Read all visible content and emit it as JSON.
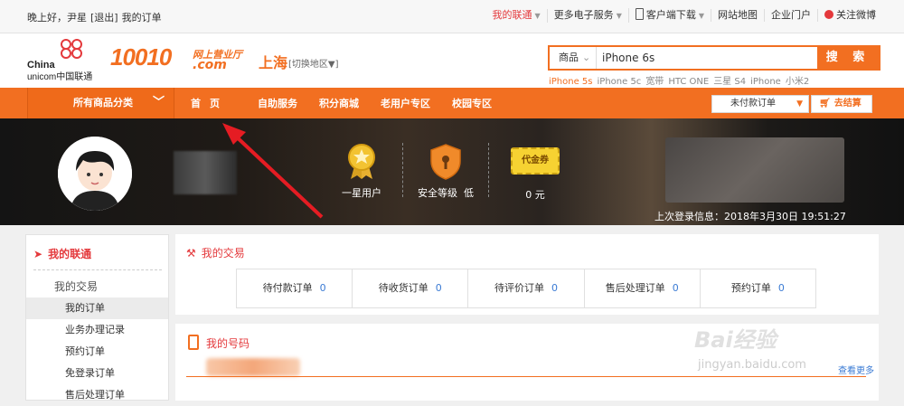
{
  "topbar": {
    "greeting": "晚上好，尹星",
    "logout": "[退出]",
    "my_orders": "我的订单",
    "links": [
      "我的联通",
      "更多电子服务",
      "客户端下载",
      "网站地图",
      "企业门户",
      "关注微博"
    ]
  },
  "header": {
    "logo_line1": "China",
    "logo_line2": "unicom中国联通",
    "brand": "10010",
    "brand_sub": "网上营业厅",
    "brand_com": ".com",
    "city": "上海",
    "city_switch": "[切换地区▼]",
    "search_category": "商品",
    "search_value": "iPhone 6s",
    "search_button": "搜 索",
    "hot_words": [
      "iPhone 5s",
      "iPhone 5c",
      "宽带",
      "HTC ONE",
      "三星 S4",
      "iPhone",
      "小米2"
    ]
  },
  "nav": {
    "all_categories": "所有商品分类",
    "items": [
      "首页",
      "自助服务",
      "积分商城",
      "老用户专区",
      "校园专区"
    ],
    "unpaid_select": "未付款订单",
    "checkout": "去结算"
  },
  "banner": {
    "level_label": "一星用户",
    "security_label": "安全等级  低",
    "coupon_badge": "代金券",
    "coupon_value": "0 元",
    "last_login": "上次登录信息：2018年3月30日 19:51:27"
  },
  "sidebar": {
    "title": "我的联通",
    "section": "我的交易",
    "items": [
      "我的订单",
      "业务办理记录",
      "预约订单",
      "免登录订单",
      "售后处理订单"
    ]
  },
  "transactions": {
    "title": "我的交易",
    "orders": [
      {
        "label": "待付款订单",
        "count": "0"
      },
      {
        "label": "待收货订单",
        "count": "0"
      },
      {
        "label": "待评价订单",
        "count": "0"
      },
      {
        "label": "售后处理订单",
        "count": "0"
      },
      {
        "label": "预约订单",
        "count": "0"
      }
    ]
  },
  "numbers": {
    "title": "我的号码",
    "more": "查看更多"
  },
  "watermark": {
    "text1": "Bai经验",
    "text2": "jingyan.baidu.com"
  },
  "colors": {
    "accent": "#f26f21",
    "red": "#e4393c",
    "link": "#3b7bd4"
  }
}
